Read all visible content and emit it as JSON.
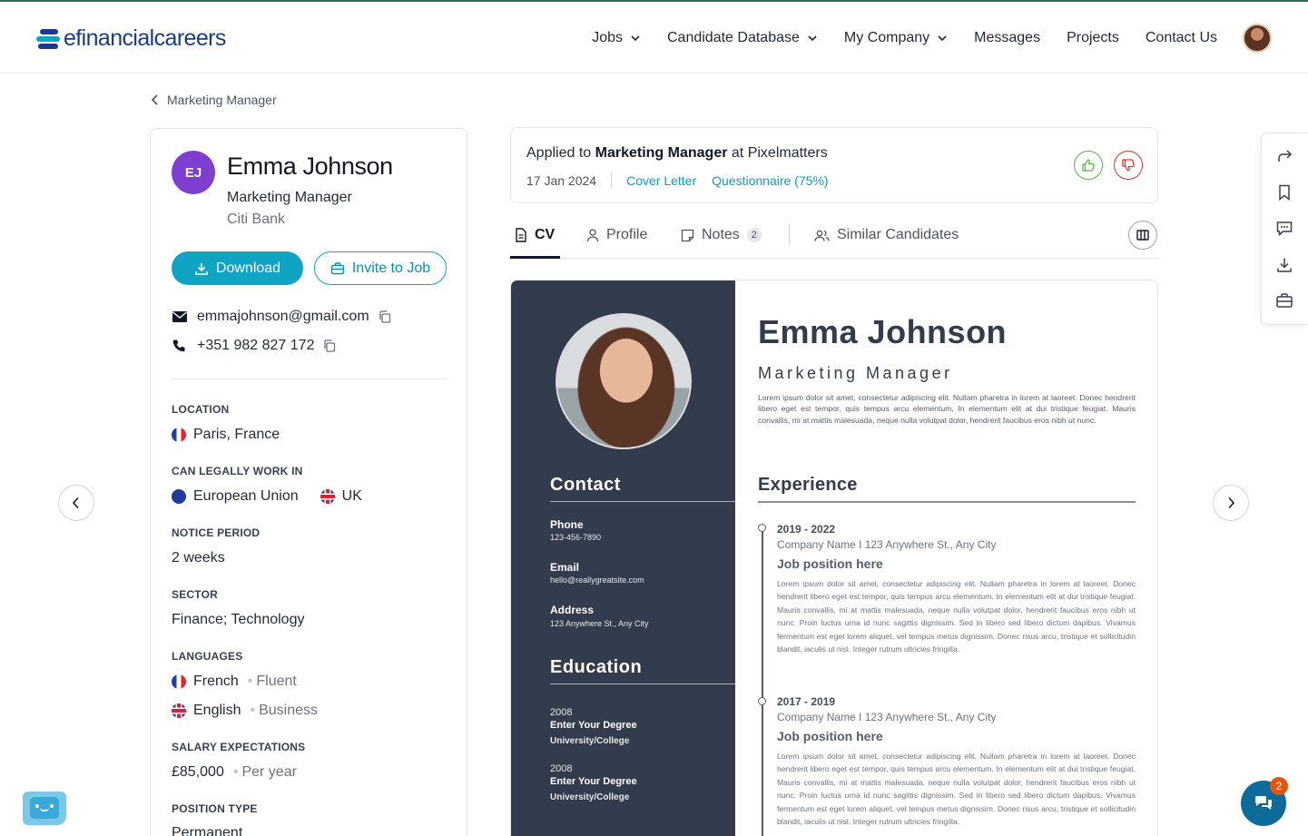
{
  "brand": {
    "logo_text": "efinancialcareers",
    "accent": "#0fa3c4",
    "navy": "#1b3a8c"
  },
  "nav": {
    "items": [
      {
        "label": "Jobs",
        "dropdown": true
      },
      {
        "label": "Candidate Database",
        "dropdown": true
      },
      {
        "label": "My Company",
        "dropdown": true
      },
      {
        "label": "Messages",
        "dropdown": false
      },
      {
        "label": "Projects",
        "dropdown": false
      },
      {
        "label": "Contact Us",
        "dropdown": false
      }
    ]
  },
  "breadcrumb": {
    "label": "Marketing Manager"
  },
  "candidate": {
    "initials": "EJ",
    "name": "Emma Johnson",
    "title": "Marketing Manager",
    "company": "Citi Bank",
    "download_label": "Download",
    "invite_label": "Invite to Job",
    "email": "emmajohnson@gmail.com",
    "phone": "+351 982 827 172",
    "sections": {
      "location_label": "LOCATION",
      "location": "Paris, France",
      "work_label": "CAN LEGALLY WORK IN",
      "work_1": "European Union",
      "work_2": "UK",
      "notice_label": "NOTICE PERIOD",
      "notice": "2 weeks",
      "sector_label": "SECTOR",
      "sector": "Finance; Technology",
      "languages_label": "LANGUAGES",
      "lang_1": "French",
      "lang_1_level": "Fluent",
      "lang_2": "English",
      "lang_2_level": "Business",
      "salary_label": "SALARY EXPECTATIONS",
      "salary": "£85,000",
      "salary_period": "Per year",
      "position_label": "POSITION TYPE",
      "position": "Permanent"
    }
  },
  "application": {
    "prefix": "Applied to",
    "job": "Marketing Manager",
    "at": "at",
    "company": "Pixelmatters",
    "date": "17 Jan 2024",
    "cover_letter": "Cover Letter",
    "questionnaire": "Questionnaire (75%)"
  },
  "tabs": [
    {
      "label": "CV",
      "active": true
    },
    {
      "label": "Profile",
      "active": false
    },
    {
      "label": "Notes",
      "count": "2",
      "active": false
    },
    {
      "label": "Similar Candidates",
      "active": false
    }
  ],
  "cv": {
    "name": "Emma Johnson",
    "title": "Marketing Manager",
    "summary": "Lorem ipsum dolor sit amet, consectetur adipiscing elit. Nullam pharetra in lorem at laoreet. Donec hendrerit libero eget est tempor, quis tempus arcu elementum. In elementum elit at dui tristique feugiat. Mauris convallis, mi at mattis malesuada, neque nulla volutpat dolor, hendrerit faucibus eros nibh ut nunc.",
    "contact_head": "Contact",
    "phone_k": "Phone",
    "phone_v": "123-456-7890",
    "email_k": "Email",
    "email_v": "hello@reallygreatsite.com",
    "address_k": "Address",
    "address_v": "123 Anywhere St., Any City",
    "education_head": "Education",
    "edu": [
      {
        "year": "2008",
        "degree": "Enter Your Degree",
        "school": "University/College"
      },
      {
        "year": "2008",
        "degree": "Enter Your Degree",
        "school": "University/College"
      }
    ],
    "experience_head": "Experience",
    "jobs": [
      {
        "years": "2019 - 2022",
        "company": "Company Name I 123 Anywhere St., Any City",
        "position": "Job position here",
        "text": "Lorem ipsum dolor sit amet, consectetur adipiscing elit. Nullam pharetra in lorem at laoreet. Donec hendrerit libero eget est tempor, quis tempus arcu elementum. In elementum elit at dui tristique feugiat. Mauris convallis, mi at mattis malesuada, neque nulla volutpat dolor, hendrerit faucibus eros nibh ut nunc. Proin luctus urna id nunc sagittis dignissim. Sed in libero sed libero dictum dapibus. Vivamus fermentum est eget lorem aliquet, vel tempus metus dignissim. Donec risus arcu, tristique et sollicitudin blandit, iaculis ut nisl. Integer rutrum ultricies fringilla."
      },
      {
        "years": "2017 - 2019",
        "company": "Company Name I 123 Anywhere St., Any City",
        "position": "Job position here",
        "text": "Lorem ipsum dolor sit amet, consectetur adipiscing elit. Nullam pharetra in lorem at laoreet. Donec hendrerit libero eget est tempor, quis tempus arcu elementum. In elementum elit at dui tristique feugiat. Mauris convallis, mi at mattis malesuada, neque nulla volutpat dolor, hendrerit faucibus eros nibh ut nunc. Proin luctus urna id nunc sagittis dignissim. Sed in libero sed libero dictum dapibus. Vivamus fermentum est eget lorem aliquet, vel tempus metus dignissim. Donec risus arcu, tristique et sollicitudin blandit, iaculis ut nisl. Integer rutrum ultricies fringilla."
      }
    ]
  },
  "right_toolbar": [
    "share-icon",
    "bookmark-icon",
    "comment-icon",
    "download-icon",
    "briefcase-icon"
  ],
  "chat": {
    "badge": "2"
  }
}
